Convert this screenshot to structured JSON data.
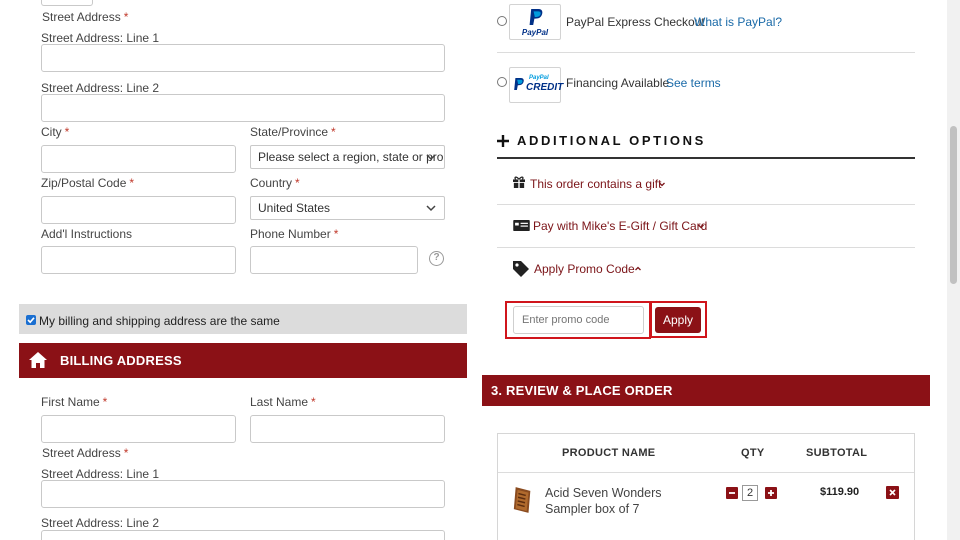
{
  "shipping": {
    "street_label": "Street Address",
    "line1_label": "Street Address: Line 1",
    "line2_label": "Street Address: Line 2",
    "city_label": "City",
    "state_label": "State/Province",
    "state_value": "Please select a region, state or pro",
    "zip_label": "Zip/Postal Code",
    "country_label": "Country",
    "country_value": "United States",
    "addl_label": "Add'l Instructions",
    "phone_label": "Phone Number",
    "help_glyph": "?"
  },
  "same_address_label": "My billing and shipping address are the same",
  "billing": {
    "title": "BILLING ADDRESS",
    "first_label": "First Name",
    "last_label": "Last Name",
    "street_label": "Street Address",
    "line1_label": "Street Address: Line 1",
    "line2_label": "Street Address: Line 2"
  },
  "payment": {
    "paypal_logo_text": "PayPal",
    "paypal_label": "PayPal Express Checkout",
    "paypal_link": "What is PayPal?",
    "credit_logo_top": "PayPal",
    "credit_logo_text": "CREDIT",
    "credit_label": "Financing Available",
    "credit_link": "See terms"
  },
  "additional": {
    "title": "ADDITIONAL OPTIONS",
    "gift_label": "This order contains a gift",
    "egift_label": "Pay with Mike's E-Gift / Gift Card",
    "promo_label": "Apply Promo Code",
    "promo_placeholder": "Enter promo code",
    "apply_label": "Apply"
  },
  "review": {
    "title": "3. REVIEW & PLACE ORDER",
    "headers": {
      "name": "PRODUCT NAME",
      "qty": "QTY",
      "subtotal": "SUBTOTAL"
    },
    "items": [
      {
        "name_line1": "Acid Seven Wonders",
        "name_line2": "Sampler box of 7",
        "qty": "2",
        "subtotal": "$119.90"
      }
    ]
  },
  "colors": {
    "brand": "#8b1116",
    "link": "#1a6aa8",
    "highlight": "#d0151c"
  }
}
